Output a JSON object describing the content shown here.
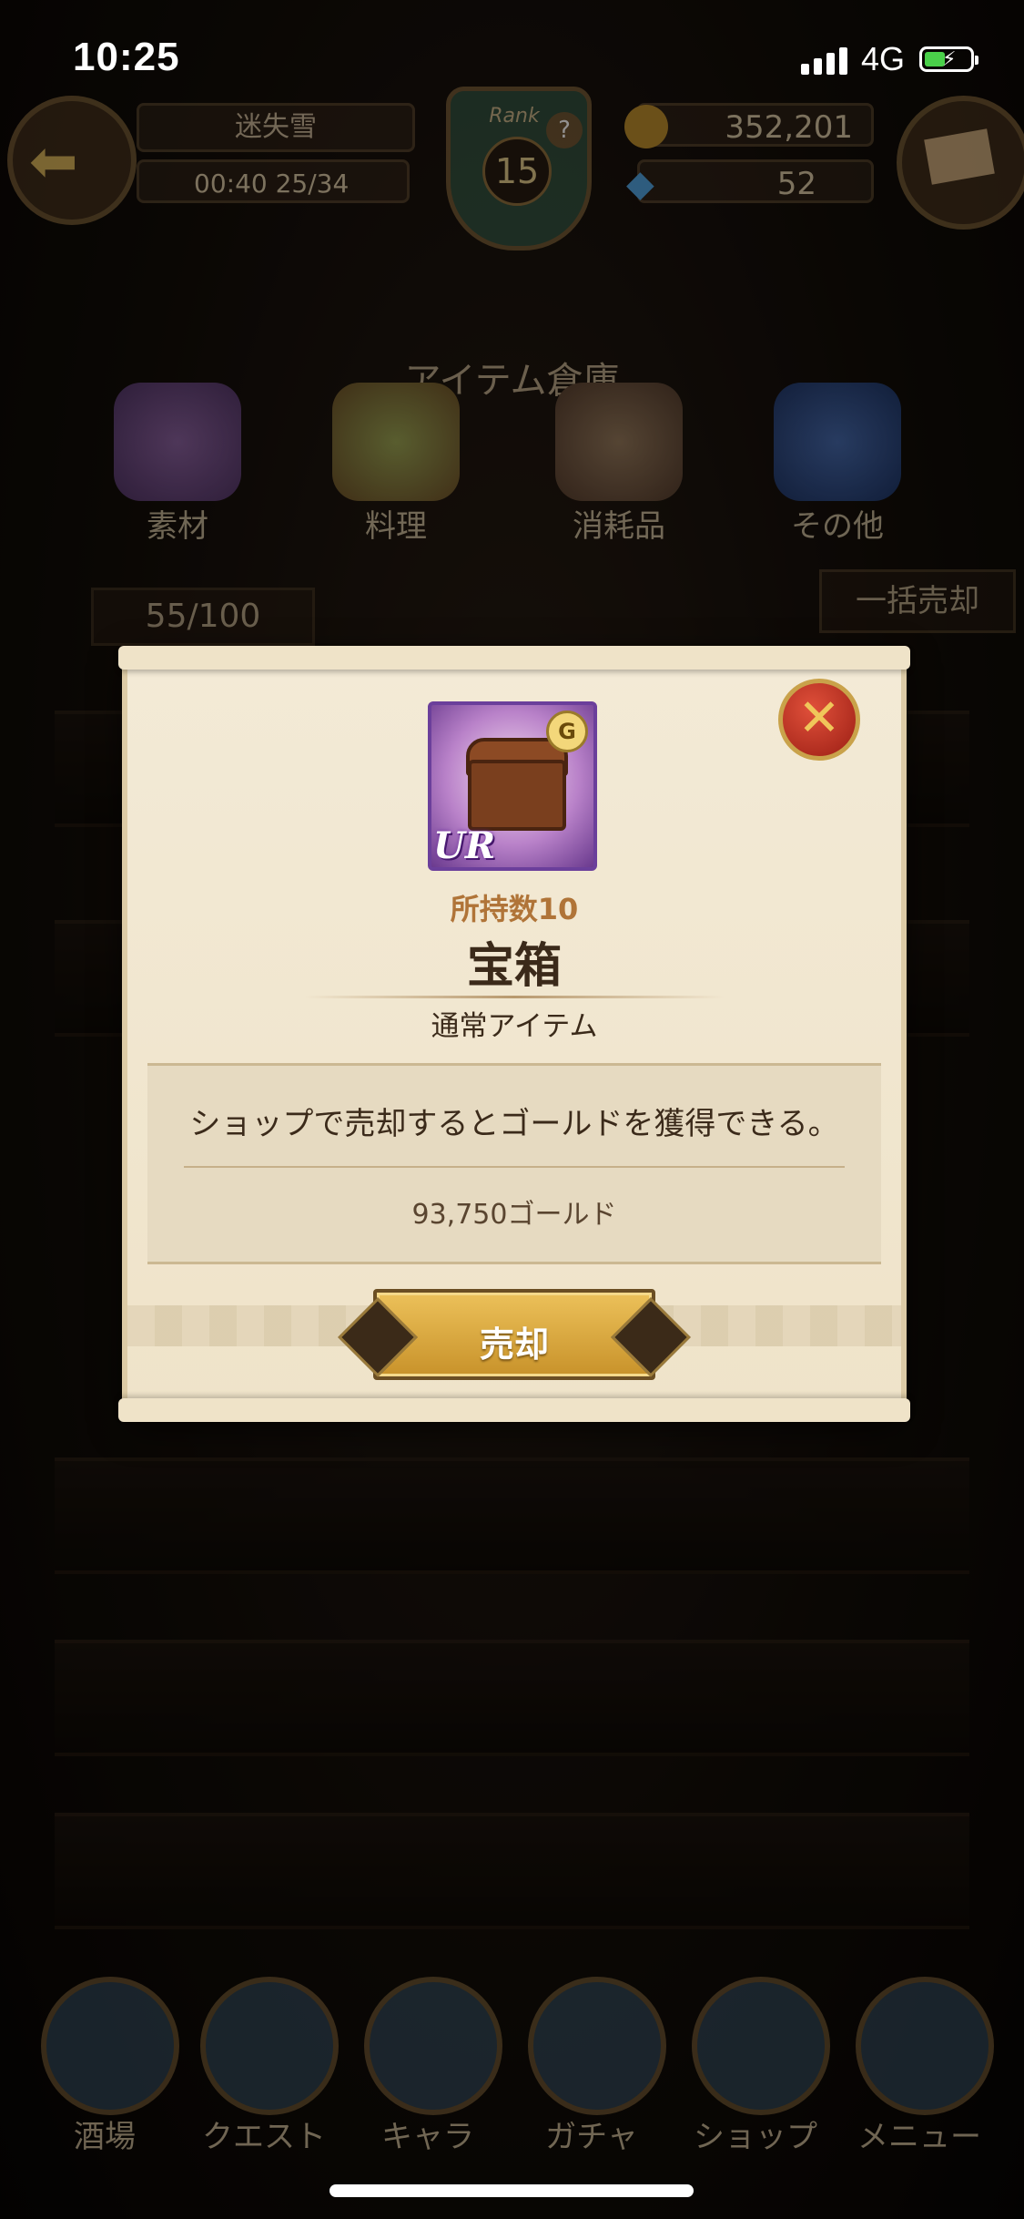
{
  "status_bar": {
    "time": "10:25",
    "network": "4G"
  },
  "header": {
    "player_name": "迷失雪",
    "stamina_timer": "00:40",
    "stamina": "25/34",
    "rank_label": "Rank",
    "rank_value": "15",
    "gold": "352,201",
    "gems": "52"
  },
  "warehouse": {
    "title": "アイテム倉庫",
    "tabs": [
      {
        "label": "素材"
      },
      {
        "label": "料理"
      },
      {
        "label": "消耗品"
      },
      {
        "label": "その他"
      }
    ],
    "capacity": "55/100",
    "sell_all_label": "一括売却"
  },
  "modal": {
    "owned_count": "所持数10",
    "item_name": "宝箱",
    "item_type": "通常アイテム",
    "description": "ショップで売却するとゴールドを獲得できる。",
    "sell_price": "93,750ゴールド",
    "sell_button": "売却",
    "rarity": "UR",
    "badge": "G"
  },
  "bottom_nav": [
    {
      "label": "酒場",
      "icon": "tavern-icon"
    },
    {
      "label": "クエスト",
      "icon": "scroll-icon"
    },
    {
      "label": "キャラ",
      "icon": "helmet-icon"
    },
    {
      "label": "ガチャ",
      "icon": "crystal-icon"
    },
    {
      "label": "ショップ",
      "icon": "shop-icon"
    },
    {
      "label": "メニュー",
      "icon": "gear-icon"
    }
  ],
  "colors": {
    "accent_gold": "#c8922a",
    "close_red": "#9b1e14",
    "parchment": "#f3ead6",
    "rarity_purple": "#6b3f9b"
  }
}
